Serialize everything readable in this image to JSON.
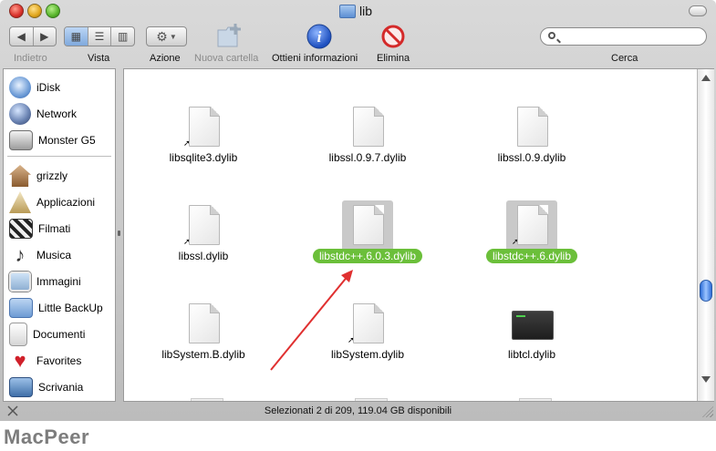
{
  "window": {
    "title": "lib"
  },
  "toolbar": {
    "back_label": "Indietro",
    "view_label": "Vista",
    "action_label": "Azione",
    "new_folder_label": "Nuova cartella",
    "info_label": "Ottieni informazioni",
    "delete_label": "Elimina",
    "search_label": "Cerca",
    "search_placeholder": "",
    "view_modes": [
      "icon",
      "list",
      "column"
    ],
    "active_view": "icon"
  },
  "sidebar": {
    "items": [
      {
        "label": "iDisk",
        "icon": "idisk-icon"
      },
      {
        "label": "Network",
        "icon": "network-globe-icon"
      },
      {
        "label": "Monster G5",
        "icon": "hard-drive-icon"
      },
      {
        "label": "grizzly",
        "icon": "home-icon"
      },
      {
        "label": "Applicazioni",
        "icon": "applications-icon"
      },
      {
        "label": "Filmati",
        "icon": "movies-clapper-icon"
      },
      {
        "label": "Musica",
        "icon": "music-note-icon"
      },
      {
        "label": "Immagini",
        "icon": "pictures-icon"
      },
      {
        "label": "Little BackUp",
        "icon": "folder-icon"
      },
      {
        "label": "Documenti",
        "icon": "documents-icon"
      },
      {
        "label": "Favorites",
        "icon": "heart-icon"
      },
      {
        "label": "Scrivania",
        "icon": "desktop-icon"
      }
    ]
  },
  "files": [
    {
      "name": "libsqlite3.dylib",
      "alias": true,
      "selected": false,
      "kind": "doc"
    },
    {
      "name": "libssl.0.9.7.dylib",
      "alias": false,
      "selected": false,
      "kind": "doc"
    },
    {
      "name": "libssl.0.9.dylib",
      "alias": false,
      "selected": false,
      "kind": "doc"
    },
    {
      "name": "libssl.dylib",
      "alias": true,
      "selected": false,
      "kind": "doc"
    },
    {
      "name": "libstdc++.6.0.3.dylib",
      "alias": false,
      "selected": true,
      "kind": "doc"
    },
    {
      "name": "libstdc++.6.dylib",
      "alias": true,
      "selected": true,
      "kind": "doc"
    },
    {
      "name": "libSystem.B.dylib",
      "alias": false,
      "selected": false,
      "kind": "doc"
    },
    {
      "name": "libSystem.dylib",
      "alias": true,
      "selected": false,
      "kind": "doc"
    },
    {
      "name": "libtcl.dylib",
      "alias": false,
      "selected": false,
      "kind": "terminal"
    }
  ],
  "status": {
    "text": "Selezionati 2 di 209, 119.04 GB disponibili"
  },
  "brand": {
    "text": "MacPeer"
  },
  "colors": {
    "selection": "#6bbf3a",
    "annotation_arrow": "#e03030"
  }
}
